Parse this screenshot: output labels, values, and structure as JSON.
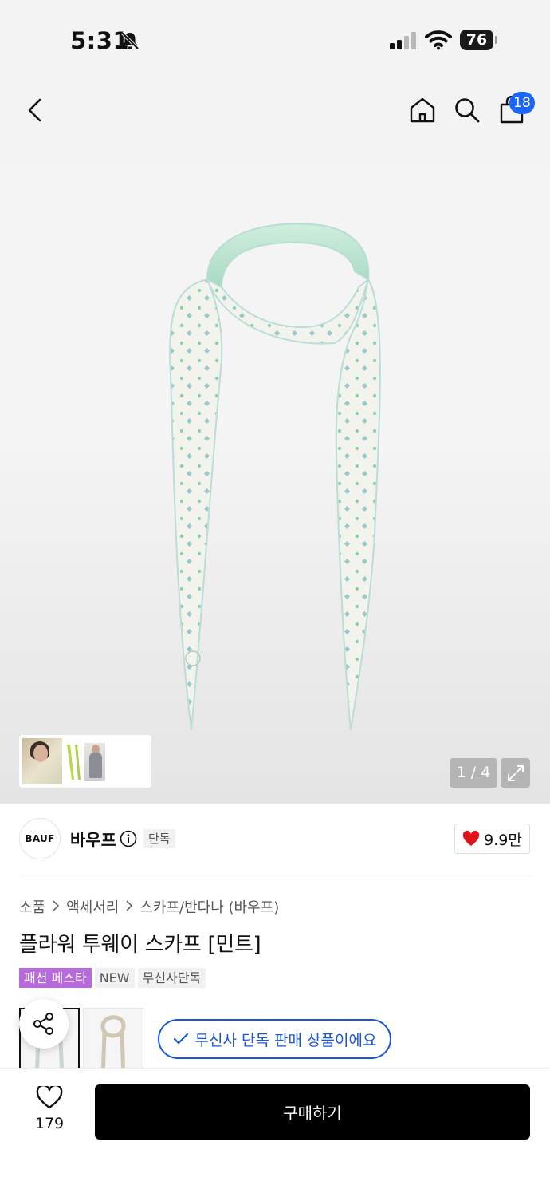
{
  "status_bar": {
    "time": "5:31",
    "battery": "76"
  },
  "nav": {
    "cart_count": "18"
  },
  "gallery": {
    "counter": "1 / 4"
  },
  "brand": {
    "logo_text": "BAUF",
    "name": "바우프",
    "exclusive_tag": "단독",
    "likes": "9.9만"
  },
  "breadcrumb": [
    "소품",
    "액세서리",
    "스카프/반다나 (바우프)"
  ],
  "product": {
    "title": "플라워 투웨이 스카프 [민트]",
    "tags": [
      "패션 페스타",
      "NEW",
      "무신사단독"
    ]
  },
  "notice": {
    "text": "무신사 단독 판매 상품이에요"
  },
  "bottom_bar": {
    "wish_count": "179",
    "buy_label": "구매하기"
  },
  "colors": {
    "accent_blue": "#1a57d6",
    "badge_blue": "#1a66ff",
    "festa_purple": "#b769dd",
    "heart_red": "#e0151b",
    "scarf_mint": "#a9d9c2"
  },
  "icons": [
    "bell-slash-icon",
    "signal-icon",
    "wifi-icon",
    "battery-icon",
    "back-icon",
    "home-icon",
    "search-icon",
    "shopping-bag-icon",
    "expand-icon",
    "info-icon",
    "heart-filled-icon",
    "chevron-right-icon",
    "share-icon",
    "check-icon",
    "heart-outline-icon"
  ]
}
